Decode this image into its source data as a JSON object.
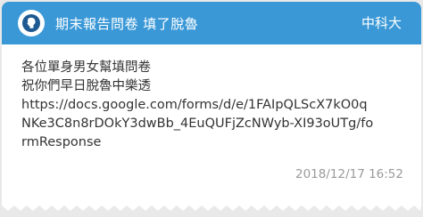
{
  "header": {
    "title": "期末報告問卷 填了脫魯",
    "board": "中科大",
    "avatar_icon": "person-silhouette-icon",
    "accent_color": "#3a98d7"
  },
  "post": {
    "lines": [
      "各位單身男女幫填問卷",
      "祝你們早日脫魯中樂透"
    ],
    "url_lines": [
      "https://docs.google.com/forms/d/e/1FAIpQLScX7kO0q",
      "NKe3C8n8rDOkY3dwBb_4EuQUFjZcNWyb-XI93oUTg/fo",
      "rmResponse"
    ],
    "timestamp": "2018/12/17 16:52"
  }
}
